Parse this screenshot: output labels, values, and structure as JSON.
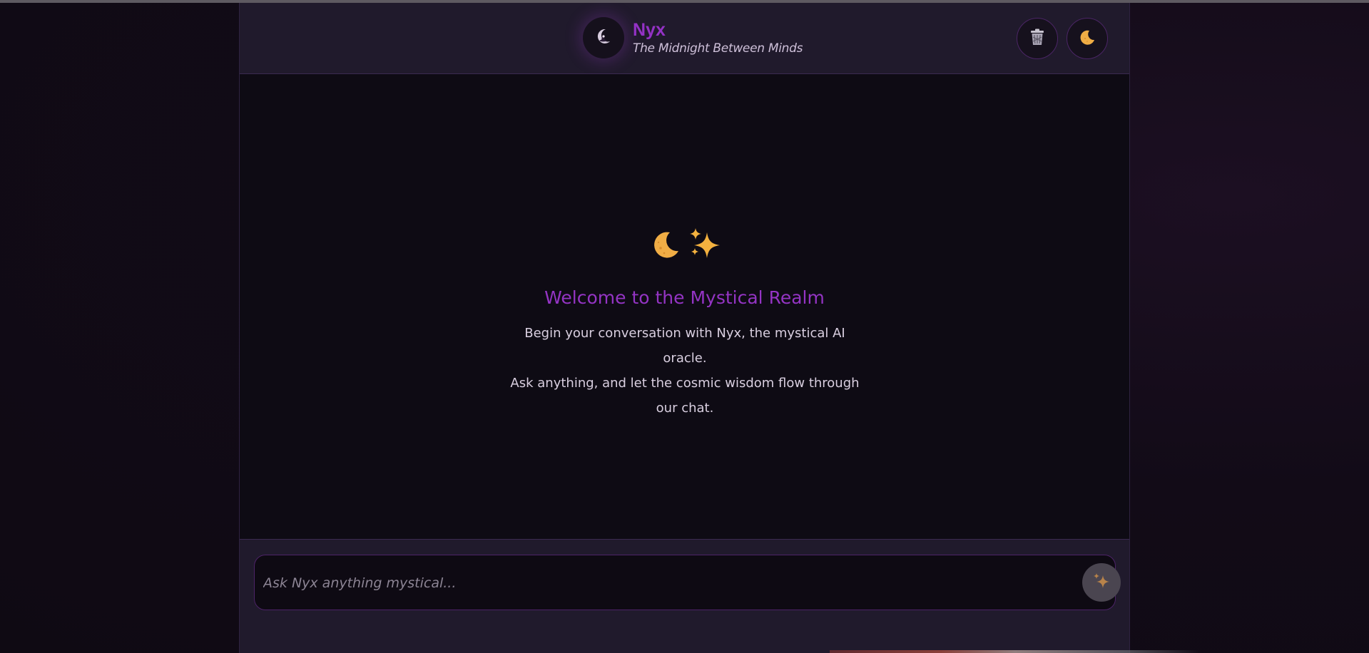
{
  "header": {
    "brand_name": "Nyx",
    "tagline": "The Midnight Between Minds",
    "avatar_icon": "witch-moon-icon",
    "buttons": [
      {
        "name": "clear-chat-button",
        "icon": "trash-icon"
      },
      {
        "name": "theme-toggle-button",
        "icon": "crescent-moon-icon"
      }
    ]
  },
  "welcome": {
    "icons": [
      "crescent-moon-icon",
      "sparkles-icon"
    ],
    "title": "Welcome to the Mystical Realm",
    "line1": "Begin your conversation with Nyx, the mystical AI oracle.",
    "line2": "Ask anything, and let the cosmic wisdom flow through",
    "line3": "our chat."
  },
  "composer": {
    "placeholder": "Ask Nyx anything mystical...",
    "value": "",
    "send_icon": "sparkles-icon"
  },
  "colors": {
    "accent_purple": "#9432c6",
    "header_bg": "#201a2c",
    "chat_bg": "#0e0b14",
    "moon_gold": "#f0b04a"
  }
}
